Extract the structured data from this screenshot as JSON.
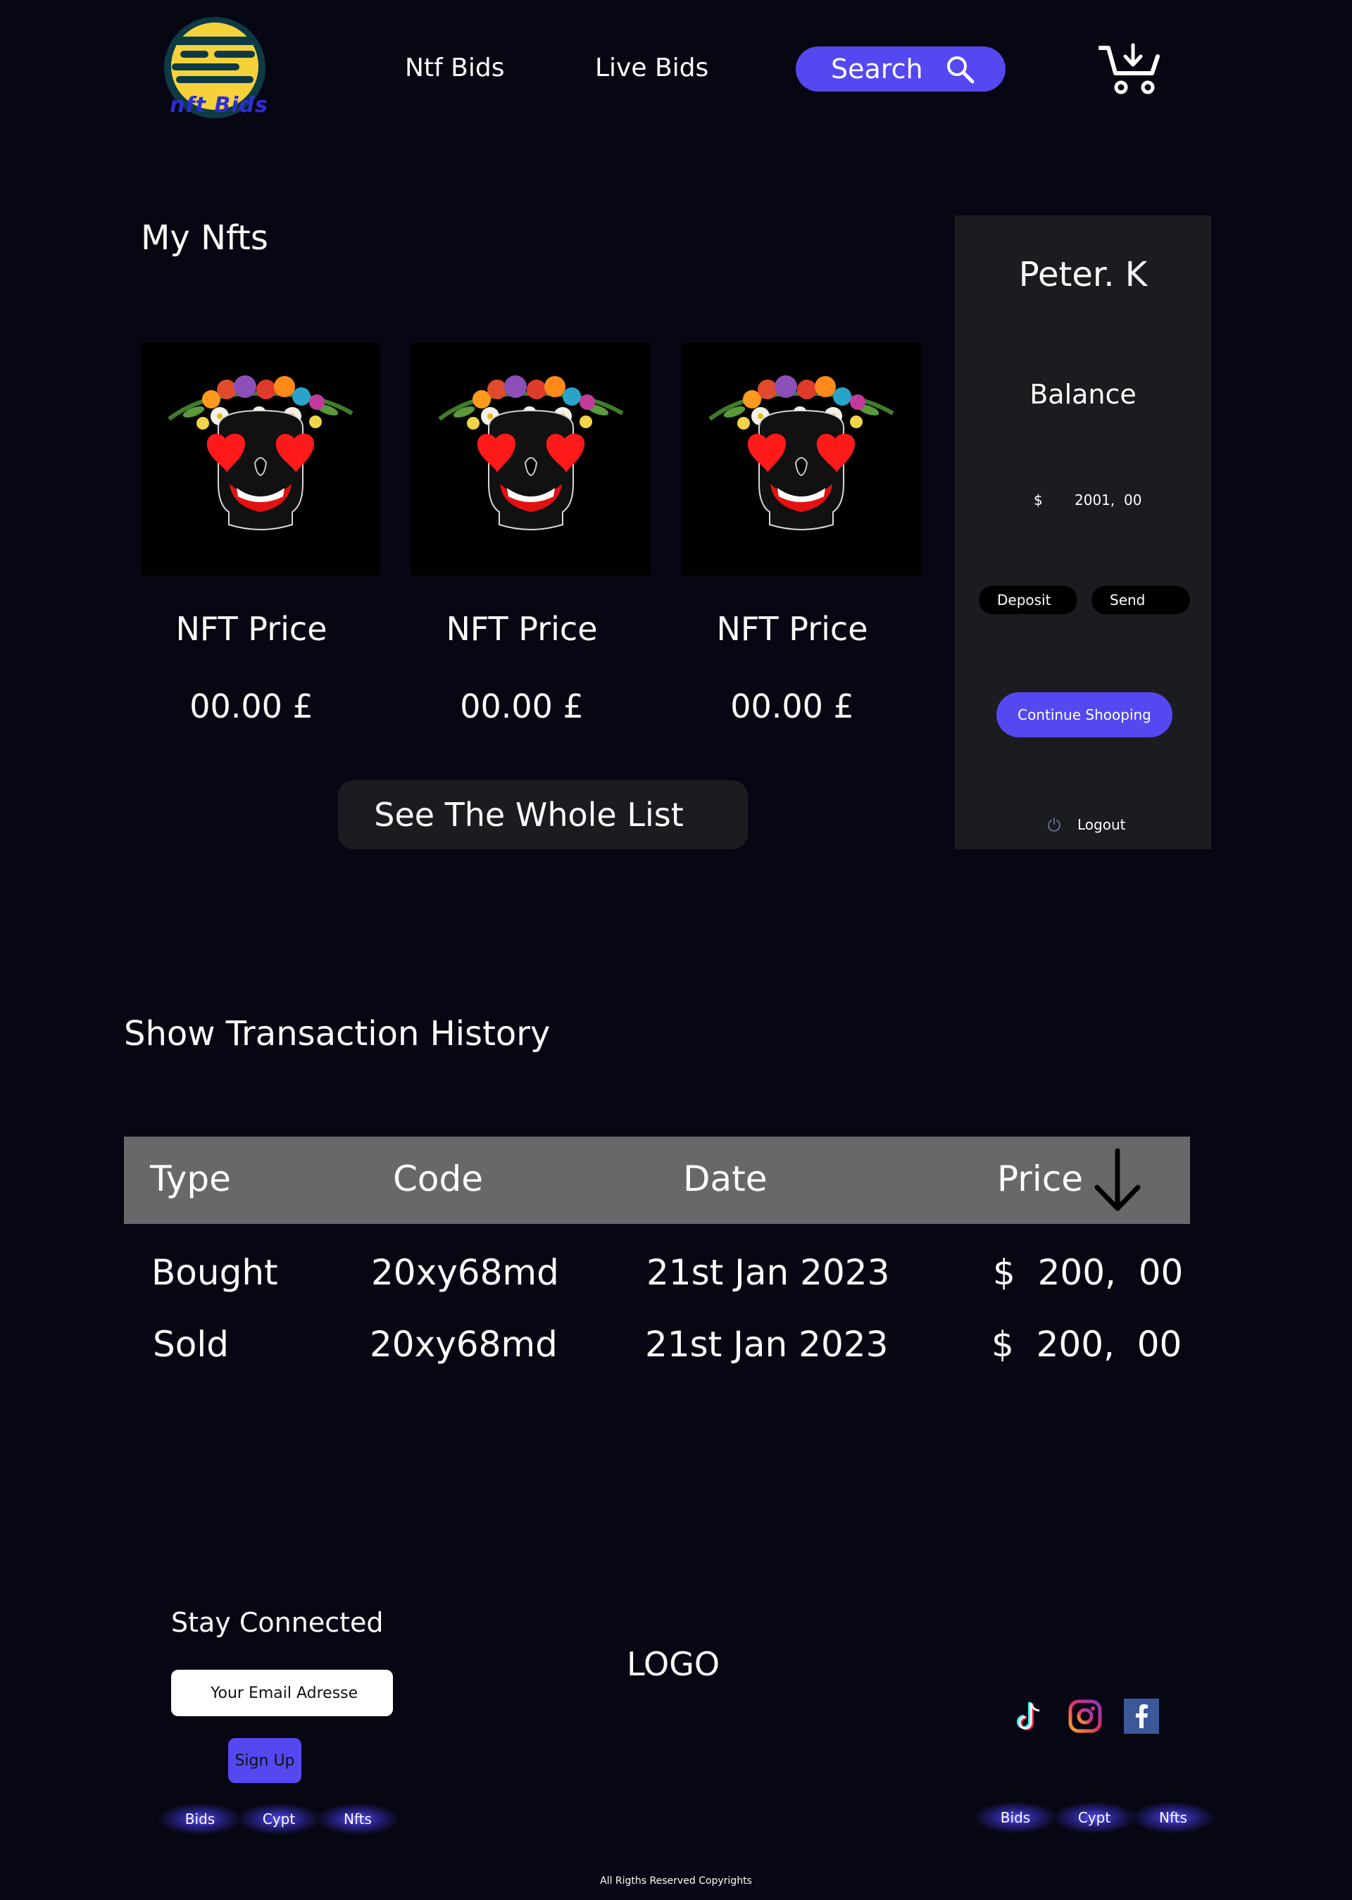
{
  "header": {
    "logo_text": "nft Bids",
    "nav": [
      "Ntf Bids",
      "Live Bids"
    ],
    "search_label": "Search"
  },
  "nfts": {
    "title": "My Nfts",
    "cards": [
      {
        "label": "NFT Price",
        "price": "00.00 £"
      },
      {
        "label": "NFT Price",
        "price": "00.00 £"
      },
      {
        "label": "NFT Price",
        "price": "00.00 £"
      }
    ],
    "see_all_label": "See  The Whole List"
  },
  "profile": {
    "name": "Peter.  K",
    "balance_label": "Balance",
    "currency": "$",
    "amount": "2001,  00",
    "deposit_label": "Deposit",
    "send_label": "Send",
    "continue_label": "Continue Shooping",
    "logout_label": "Logout"
  },
  "transactions": {
    "title": "Show Transaction  History",
    "columns": [
      "Type",
      "Code",
      "Date",
      "Price"
    ],
    "rows": [
      {
        "type": "Bought",
        "code": "20xy68md",
        "date": "21st Jan 2023",
        "price": "$  200,  00"
      },
      {
        "type": "Sold",
        "code": "20xy68md",
        "date": "21st Jan 2023",
        "price": "$  200,  00"
      }
    ]
  },
  "footer": {
    "stay_connected": "Stay Connected",
    "email_placeholder": "Your Email Adresse",
    "signup_label": "Sign Up",
    "logo": "LOGO",
    "left_links": [
      "Bids",
      "Cypt",
      "Nfts"
    ],
    "right_links": [
      "Bids",
      "Cypt",
      "Nfts"
    ],
    "social_icons": [
      "tiktok-icon",
      "instagram-icon",
      "facebook-icon"
    ],
    "copyright": "All Rigths Reserved Copyrights"
  },
  "colors": {
    "background": "#070713",
    "accent": "#5548f0",
    "panel": "#1b1c20",
    "table_header": "#68686a"
  }
}
